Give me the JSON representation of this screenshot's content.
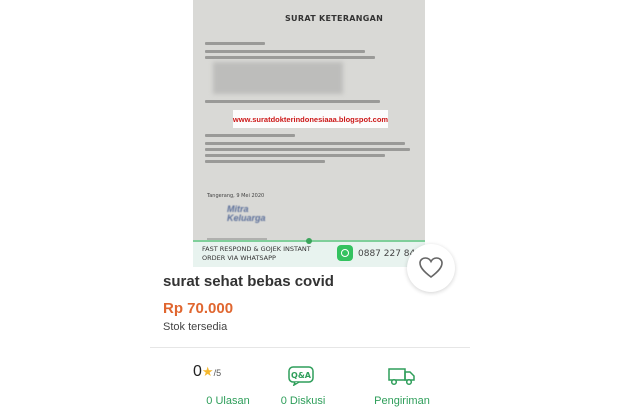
{
  "product": {
    "image": {
      "doc_title": "SURAT KETERANGAN",
      "watermark": "www.suratdokterindonesiaaa.blogspot.com",
      "date": "Tangerang, 9 Mei 2020",
      "stamp_text": "Mitra Keluarga",
      "banner_line1": "FAST RESPOND & GOJEK INSTANT",
      "banner_line2": "ORDER VIA WHATSAPP",
      "phone": "0887 227 8459"
    },
    "title": "surat sehat bebas covid",
    "price": "Rp 70.000",
    "stock": "Stok tersedia"
  },
  "stats": {
    "rating_value": "0",
    "rating_max": "/5",
    "reviews_label": "0 Ulasan",
    "discussion_label": "0 Diskusi",
    "shipping_label": "Pengiriman"
  },
  "colors": {
    "accent": "#2e9e5a",
    "price": "#e0662f",
    "star": "#f5b82e"
  },
  "icons": [
    "heart-icon",
    "star-icon",
    "qa-icon",
    "truck-icon",
    "whatsapp-icon"
  ]
}
